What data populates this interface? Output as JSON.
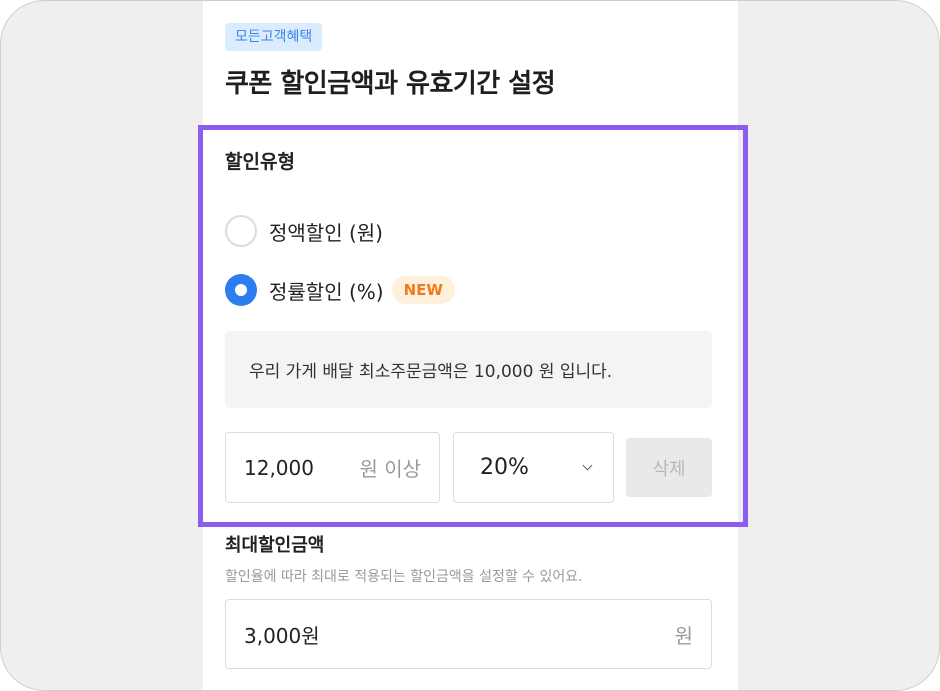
{
  "header": {
    "badge": "모든고객혜택",
    "title": "쿠폰 할인금액과 유효기간 설정"
  },
  "discount_type": {
    "label": "할인유형",
    "options": [
      {
        "label": "정액할인 (원)",
        "selected": false
      },
      {
        "label": "정률할인 (%)",
        "selected": true,
        "badge": "NEW"
      }
    ]
  },
  "info": {
    "text": "우리 가게 배달 최소주문금액은 10,000 원 입니다."
  },
  "condition": {
    "amount_value": "12,000",
    "amount_suffix": "원 이상",
    "rate_value": "20%",
    "delete_label": "삭제"
  },
  "max_discount": {
    "label": "최대할인금액",
    "description": "할인율에 따라 최대로 적용되는 할인금액을 설정할 수 있어요.",
    "value": "3,000원",
    "suffix": "원"
  },
  "colors": {
    "accent": "#2d7df0",
    "highlight": "#8a5cf0",
    "new_badge": "#f07a1e"
  }
}
